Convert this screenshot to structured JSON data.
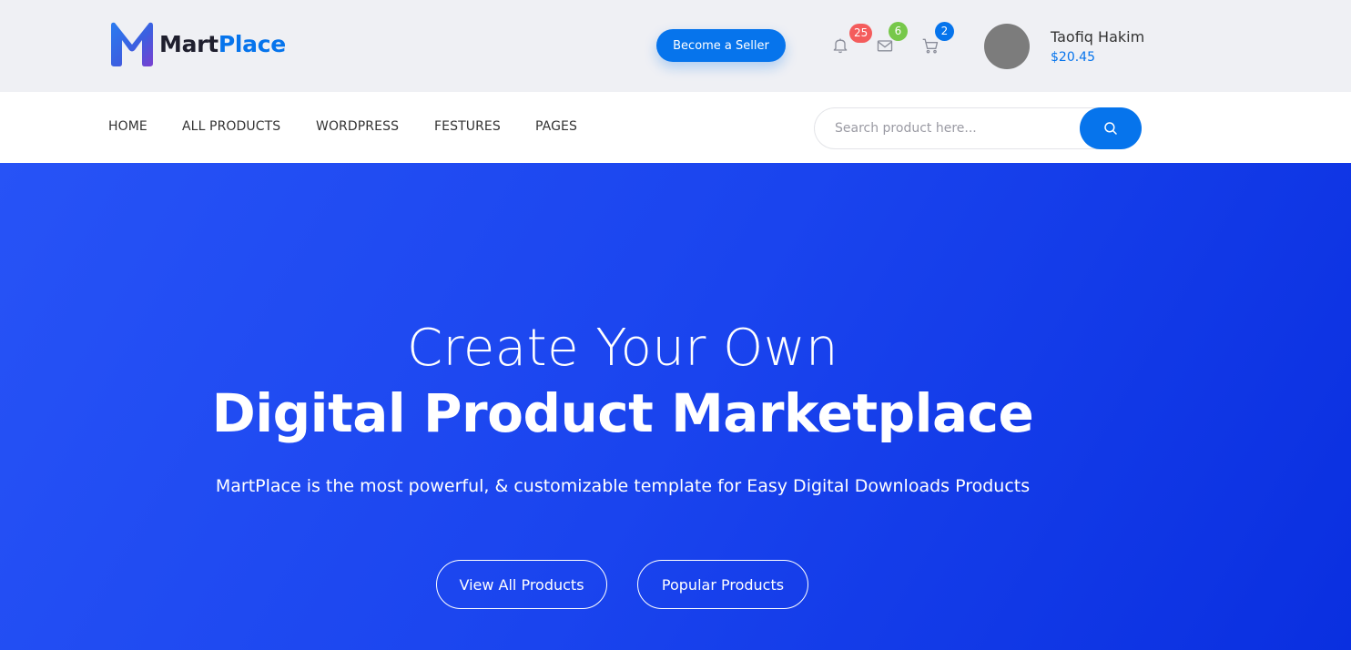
{
  "header": {
    "logo": {
      "text_part1": "Mart",
      "text_part2": "Place"
    },
    "become_seller_label": "Become a Seller",
    "notifications": {
      "icon": "bell-icon",
      "count": "25",
      "color": "#f45c5c"
    },
    "messages": {
      "icon": "envelope-icon",
      "count": "6",
      "color": "#77c84a"
    },
    "cart": {
      "icon": "cart-icon",
      "count": "2",
      "color": "#0674ec"
    },
    "user": {
      "name": "Taofiq Hakim",
      "balance": "$20.45"
    }
  },
  "nav": {
    "items": [
      {
        "label": "HOME"
      },
      {
        "label": "ALL PRODUCTS"
      },
      {
        "label": "WORDPRESS"
      },
      {
        "label": "FESTURES"
      },
      {
        "label": "PAGES"
      }
    ],
    "search": {
      "placeholder": "Search product here...",
      "icon": "search-icon"
    }
  },
  "hero": {
    "title_line1": "Create Your Own",
    "title_line2": "Digital Product Marketplace",
    "subtitle": "MartPlace is the most powerful, & customizable template for Easy Digital Downloads Products",
    "buttons": [
      {
        "label": "View All Products"
      },
      {
        "label": "Popular Products"
      }
    ]
  },
  "colors": {
    "accent": "#0674ec",
    "header_bg": "#eff0f4",
    "hero_gradient_start": "#2753f6",
    "hero_gradient_end": "#0a2fe0"
  }
}
